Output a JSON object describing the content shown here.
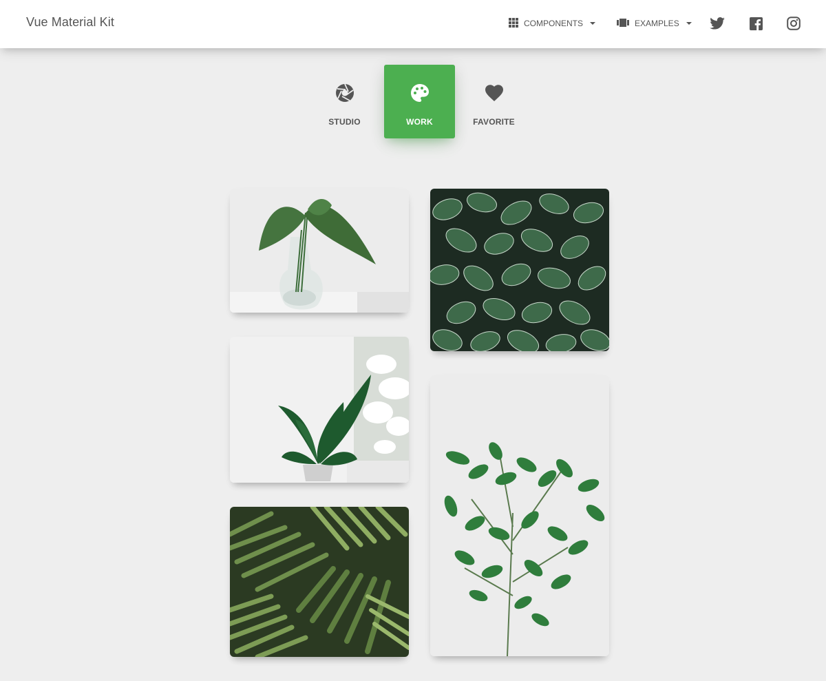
{
  "navbar": {
    "brand": "Vue Material Kit",
    "components_label": "COMPONENTS",
    "examples_label": "EXAMPLES",
    "social": [
      "twitter-icon",
      "facebook-icon",
      "instagram-icon"
    ]
  },
  "tabs": [
    {
      "label": "STUDIO",
      "icon": "camera-aperture-icon",
      "active": false
    },
    {
      "label": "WORK",
      "icon": "palette-icon",
      "active": true
    },
    {
      "label": "FAVORITE",
      "icon": "heart-icon",
      "active": false
    }
  ],
  "colors": {
    "accent": "#4caf50",
    "background": "#eeeeee",
    "navbar": "#ffffff",
    "text": "#555555"
  },
  "gallery": {
    "left_column": [
      "plant-in-glass-vase",
      "potted-plant-by-window",
      "palm-leaves"
    ],
    "right_column": [
      "fittonia-leaves",
      "green-branch-plant"
    ]
  }
}
